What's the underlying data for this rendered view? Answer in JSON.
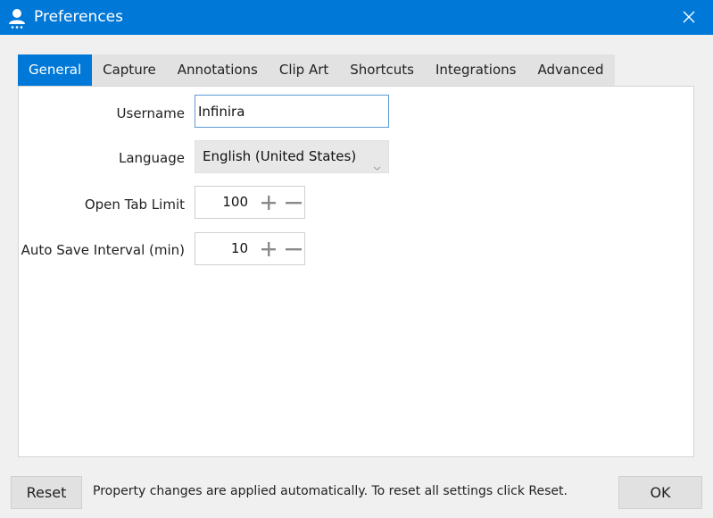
{
  "window": {
    "title": "Preferences"
  },
  "tabs": [
    {
      "label": "General",
      "active": true
    },
    {
      "label": "Capture"
    },
    {
      "label": "Annotations"
    },
    {
      "label": "Clip Art"
    },
    {
      "label": "Shortcuts"
    },
    {
      "label": "Integrations"
    },
    {
      "label": "Advanced"
    }
  ],
  "general": {
    "username": {
      "label": "Username",
      "value": "Infinira"
    },
    "language": {
      "label": "Language",
      "value": "English (United States)"
    },
    "open_tab_limit": {
      "label": "Open Tab Limit",
      "value": "100"
    },
    "auto_save_interval": {
      "label": "Auto Save Interval (min)",
      "value": "10"
    }
  },
  "footer": {
    "reset_label": "Reset",
    "status_text": "Property changes are applied automatically. To reset all settings click Reset.",
    "ok_label": "OK"
  },
  "colors": {
    "accent": "#0078d7"
  },
  "icons": {
    "app": "user-settings-icon",
    "close": "close-icon",
    "increment": "plus-icon",
    "decrement": "minus-icon",
    "dropdown": "chevron-down-icon"
  }
}
